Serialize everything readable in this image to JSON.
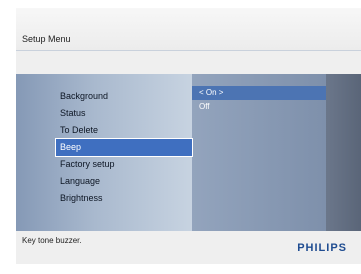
{
  "header": {
    "title": "Setup Menu"
  },
  "menu": {
    "items": [
      {
        "label": "Background",
        "selected": false
      },
      {
        "label": "Status",
        "selected": false
      },
      {
        "label": "To Delete",
        "selected": false
      },
      {
        "label": "Beep",
        "selected": true
      },
      {
        "label": "Factory setup",
        "selected": false
      },
      {
        "label": "Language",
        "selected": false
      },
      {
        "label": "Brightness",
        "selected": false
      }
    ]
  },
  "options": {
    "items": [
      {
        "label": "< On >",
        "active": true
      },
      {
        "label": "Off",
        "active": false
      }
    ]
  },
  "footer": {
    "help_text": "Key tone buzzer.",
    "brand": "PHILIPS"
  },
  "colors": {
    "selection": "#3f6fc0",
    "brand": "#1f4c91"
  }
}
